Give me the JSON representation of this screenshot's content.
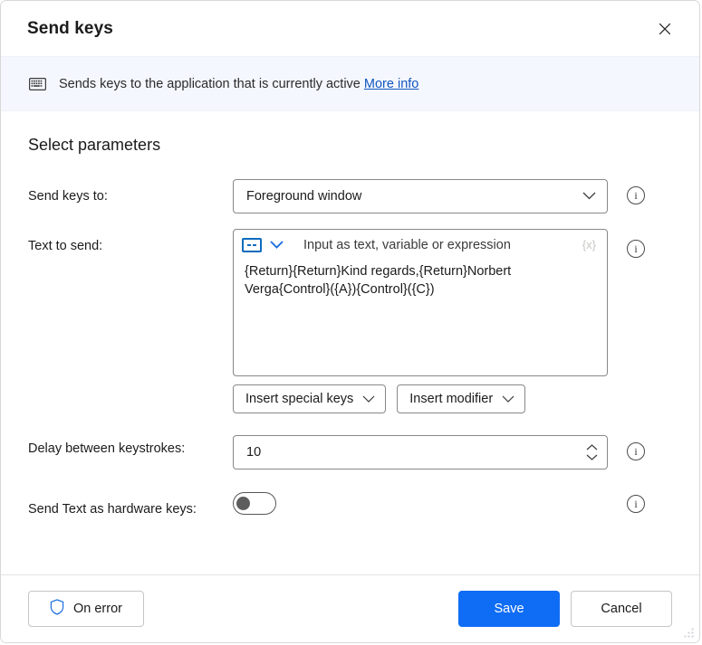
{
  "dialog": {
    "title": "Send keys",
    "close_icon": "close-icon"
  },
  "banner": {
    "icon": "keyboard-icon",
    "text": "Sends keys to the application that is currently active",
    "link_label": "More info"
  },
  "main": {
    "section_title": "Select parameters",
    "fields": {
      "send_keys_to": {
        "label": "Send keys to:",
        "value": "Foreground window",
        "chevron_icon": "chevron-down-icon",
        "info_icon": "info-icon"
      },
      "text_to_send": {
        "label": "Text to send:",
        "type_icon": "text-input-type-icon",
        "type_chevron_icon": "chevron-down-icon",
        "placeholder": "Input as text, variable or expression",
        "variable_badge": "{x}",
        "value": "{Return}{Return}Kind regards,{Return}Norbert Verga{Control}({A}){Control}({C})",
        "info_icon": "info-icon",
        "insert_special_keys_label": "Insert special keys",
        "insert_modifier_label": "Insert modifier"
      },
      "delay_between_keystrokes": {
        "label": "Delay between keystrokes:",
        "value": "10",
        "spinner_up_icon": "chevron-up-icon",
        "spinner_down_icon": "chevron-down-icon",
        "info_icon": "info-icon"
      },
      "send_text_as_hardware_keys": {
        "label": "Send Text as hardware keys:",
        "state": "off",
        "info_icon": "info-icon"
      }
    }
  },
  "footer": {
    "on_error_label": "On error",
    "on_error_icon": "shield-icon",
    "save_label": "Save",
    "cancel_label": "Cancel"
  },
  "colors": {
    "accent": "#0f6cf5",
    "link": "#1156c0",
    "banner_bg": "#f4f7fd",
    "icon_blue": "#0f6cbd",
    "border": "#8a8886"
  }
}
